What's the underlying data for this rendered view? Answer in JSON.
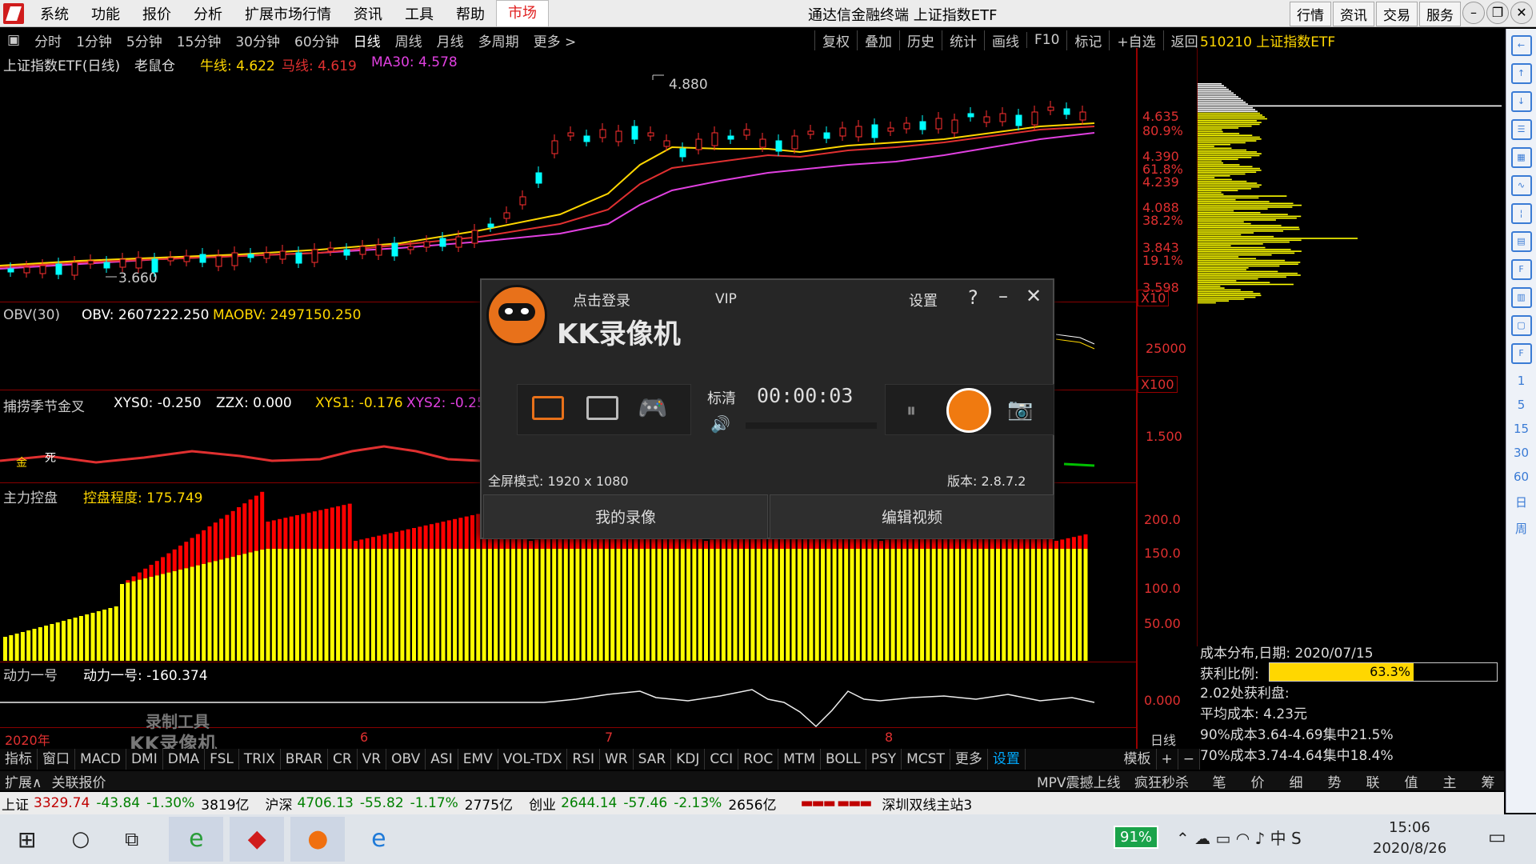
{
  "menu": {
    "items": [
      "系统",
      "功能",
      "报价",
      "分析",
      "扩展市场行情",
      "资讯",
      "工具",
      "帮助"
    ],
    "active": "市场",
    "window_title": "通达信金融终端 上证指数ETF",
    "right_buttons": [
      "行情",
      "资讯",
      "交易",
      "服务"
    ]
  },
  "toolbar": {
    "periods": [
      "分时",
      "1分钟",
      "5分钟",
      "15分钟",
      "30分钟",
      "60分钟",
      "日线",
      "周线",
      "月线",
      "多周期",
      "更多 >"
    ],
    "selected": "日线",
    "right": [
      "复权",
      "叠加",
      "历史",
      "统计",
      "画线",
      "F10",
      "标记",
      "+自选",
      "返回"
    ]
  },
  "main_legend": {
    "name": "上证指数ETF(日线)",
    "lsh": "老鼠仓",
    "niu": "牛线: 4.622",
    "ma": "马线: 4.619",
    "ma30": "MA30: 4.578",
    "high": "4.880",
    "low": "3.660"
  },
  "y_main": [
    "4.635",
    "80.9%",
    "4.390",
    "61.8%",
    "4.239",
    "4.088",
    "38.2%",
    "3.843",
    "19.1%",
    "3.598",
    "X10"
  ],
  "obv": {
    "title": "OBV(30)",
    "v1": "OBV: 2607222.250",
    "v2": "MAOBV: 2497150.250",
    "y": "25000",
    "x": "X100"
  },
  "bulao": {
    "title": "捕捞季节金叉",
    "xys0": "XYS0: -0.250",
    "zzx": "ZZX: 0.000",
    "xys1": "XYS1: -0.176",
    "xys2": "XYS2: -0.25",
    "y": "1.500",
    "jin": "金",
    "si": "死"
  },
  "zlkp": {
    "title": "主力控盘",
    "val": "控盘程度: 175.749",
    "y": [
      "200.0",
      "150.0",
      "100.0",
      "50.00"
    ]
  },
  "dl": {
    "title": "动力一号",
    "val": "动力一号: -160.374",
    "y": "0.000",
    "wm1": "录制工具",
    "wm2": "KK录像机"
  },
  "xaxis": {
    "year": "2020年",
    "m6": "6",
    "m7": "7",
    "m8": "8",
    "period": "日线"
  },
  "profile": {
    "title": "510210 上证指数ETF",
    "date": "成本分布,日期: 2020/07/15",
    "ratio_label": "获利比例:",
    "ratio": "63.3%",
    "ratio_value": 0.633,
    "l1": "2.02处获利盘:",
    "l2": "平均成本: 4.23元",
    "l3": "90%成本3.64-4.69集中21.5%",
    "l4": "70%成本3.74-4.64集中18.4%"
  },
  "indbar": {
    "items": [
      "指标",
      "窗口",
      "MACD",
      "DMI",
      "DMA",
      "FSL",
      "TRIX",
      "BRAR",
      "CR",
      "VR",
      "OBV",
      "ASI",
      "EMV",
      "VOL-TDX",
      "RSI",
      "WR",
      "SAR",
      "KDJ",
      "CCI",
      "ROC",
      "MTM",
      "BOLL",
      "PSY",
      "MCST",
      "更多",
      "设置"
    ],
    "right": [
      "模板",
      "+",
      "−"
    ]
  },
  "subbar": {
    "left": [
      "扩展∧",
      "关联报价"
    ],
    "mid": [
      "MPV震撼上线",
      "疯狂秒杀"
    ],
    "right": [
      "笔",
      "价",
      "细",
      "势",
      "联",
      "值",
      "主",
      "筹"
    ]
  },
  "status": {
    "sh": "上证",
    "sh_v": "3329.74",
    "sh_c": "-43.84",
    "sh_p": "-1.30%",
    "sh_a": "3819亿",
    "hs": "沪深",
    "hs_v": "4706.13",
    "hs_c": "-55.82",
    "hs_p": "-1.17%",
    "hs_a": "2775亿",
    "cy": "创业",
    "cy_v": "2644.14",
    "cy_c": "-57.46",
    "cy_p": "-2.13%",
    "cy_a": "2656亿",
    "station": "深圳双线主站3"
  },
  "sidebar_nums": [
    "1",
    "5",
    "15",
    "30",
    "60",
    "日",
    "周"
  ],
  "dialog": {
    "login": "点击登录",
    "vip": "VIP",
    "settings": "设置",
    "brand": "KK录像机",
    "quality": "标清",
    "timer": "00:00:03",
    "fullscreen": "全屏模式: 1920 x 1080",
    "version": "版本: 2.8.7.2",
    "my": "我的录像",
    "edit": "编辑视频"
  },
  "taskbar": {
    "battery": "91%",
    "time": "15:06",
    "date": "2020/8/26"
  }
}
